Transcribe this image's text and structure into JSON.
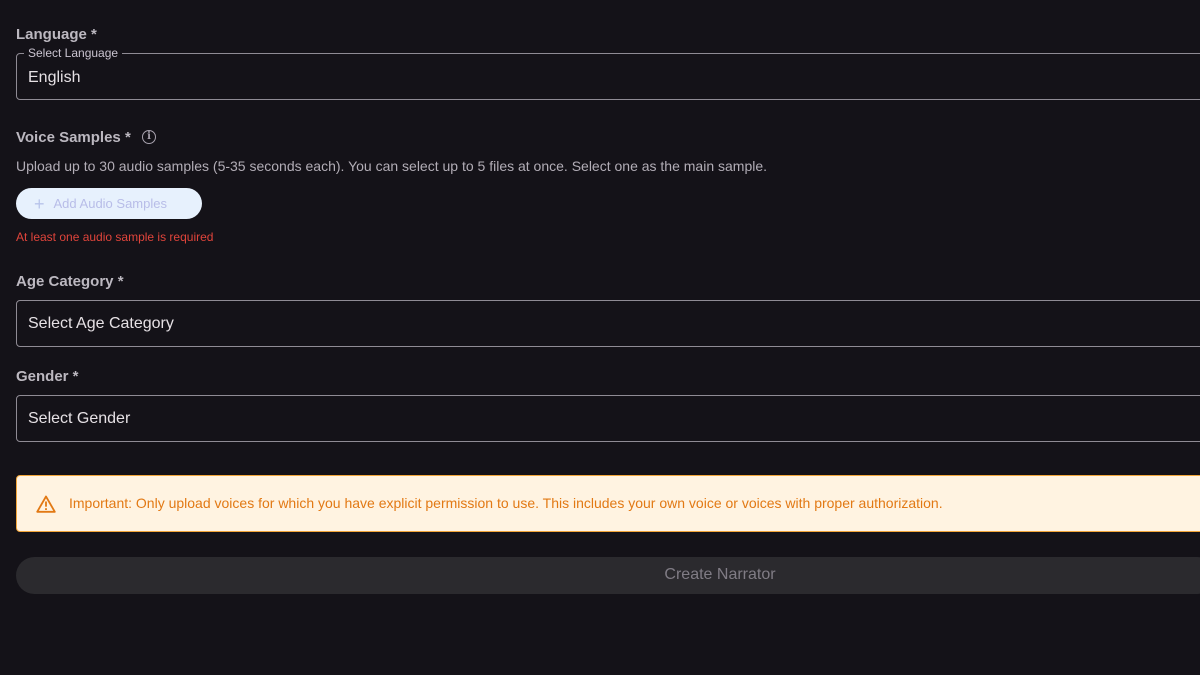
{
  "language": {
    "label": "Language *",
    "legend": "Select Language",
    "value": "English"
  },
  "voice_samples": {
    "label": "Voice Samples *",
    "info_icon": "info-icon",
    "help_text": "Upload up to 30 audio samples (5-35 seconds each). You can select up to 5 files at once. Select one as the main sample.",
    "add_button_icon": "+",
    "add_button_label": "Add Audio Samples",
    "error": "At least one audio sample is required"
  },
  "age_category": {
    "label": "Age Category *",
    "placeholder": "Select Age Category"
  },
  "gender": {
    "label": "Gender *",
    "placeholder": "Select Gender"
  },
  "alert": {
    "icon": "warning-icon",
    "message": "Important: Only upload voices for which you have explicit permission to use. This includes your own voice or voices with proper authorization."
  },
  "submit": {
    "label": "Create Narrator"
  },
  "colors": {
    "background": "#141218",
    "error": "#e0443b",
    "warning": "#e27914",
    "warning_bg": "#fff3e1",
    "add_button_bg": "#e7f1fd"
  }
}
